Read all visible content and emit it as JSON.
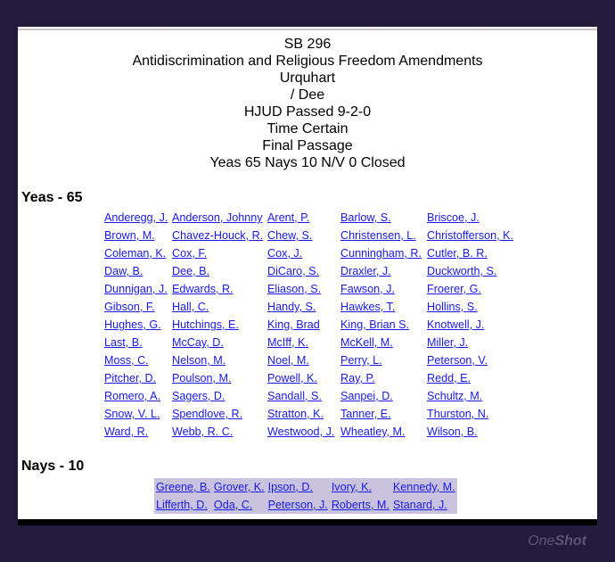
{
  "header": {
    "bill": "SB 296",
    "title": "Antidiscrimination and Religious Freedom Amendments",
    "sponsor": "Urquhart",
    "cosponsor": "/ Dee",
    "committee": "HJUD Passed 9-2-0",
    "time": "Time Certain",
    "action": "Final Passage",
    "tally": "Yeas 65 Nays 10 N/V 0 Closed"
  },
  "yeas": {
    "heading": "Yeas - 65",
    "rows": [
      [
        "Anderegg, J.",
        "Anderson, Johnny",
        "Arent, P.",
        "Barlow, S.",
        "Briscoe, J."
      ],
      [
        "Brown, M.",
        "Chavez-Houck, R.",
        "Chew, S.",
        "Christensen, L.",
        "Christofferson, K."
      ],
      [
        "Coleman, K.",
        "Cox, F.",
        "Cox, J.",
        "Cunningham, R.",
        "Cutler, B. R."
      ],
      [
        "Daw, B.",
        "Dee, B.",
        "DiCaro, S.",
        "Draxler, J.",
        "Duckworth, S."
      ],
      [
        "Dunnigan, J.",
        "Edwards, R.",
        "Eliason, S.",
        "Fawson, J.",
        "Froerer, G."
      ],
      [
        "Gibson, F.",
        "Hall, C.",
        "Handy, S.",
        "Hawkes, T.",
        "Hollins, S."
      ],
      [
        "Hughes, G.",
        "Hutchings, E.",
        "King, Brad",
        "King, Brian S.",
        "Knotwell, J."
      ],
      [
        "Last, B.",
        "McCay, D.",
        "McIff, K.",
        "McKell, M.",
        "Miller, J."
      ],
      [
        "Moss, C.",
        "Nelson, M.",
        "Noel, M.",
        "Perry, L.",
        "Peterson, V."
      ],
      [
        "Pitcher, D.",
        "Poulson, M.",
        "Powell, K.",
        "Ray, P.",
        "Redd, E."
      ],
      [
        "Romero, A.",
        "Sagers, D.",
        "Sandall, S.",
        "Sanpei, D.",
        "Schultz, M."
      ],
      [
        "Snow, V. L.",
        "Spendlove, R.",
        "Stratton, K.",
        "Tanner, E.",
        "Thurston, N."
      ],
      [
        "Ward, R.",
        "Webb, R. C.",
        "Westwood, J.",
        "Wheatley, M.",
        "Wilson, B."
      ]
    ]
  },
  "nays": {
    "heading": "Nays - 10",
    "rows": [
      [
        "Greene, B.",
        "Grover, K.",
        "Ipson, D.",
        "Ivory, K.",
        "Kennedy, M."
      ],
      [
        "Lifferth, D.",
        "Oda, C.",
        "Peterson, J.",
        "Roberts, M.",
        "Stanard, J."
      ]
    ]
  },
  "brand": {
    "prefix": "One",
    "suffix": "Shot"
  },
  "colors": {
    "link": "#1a1ae6",
    "nays_highlight": "#c9c3df",
    "background": "#231b3b"
  }
}
